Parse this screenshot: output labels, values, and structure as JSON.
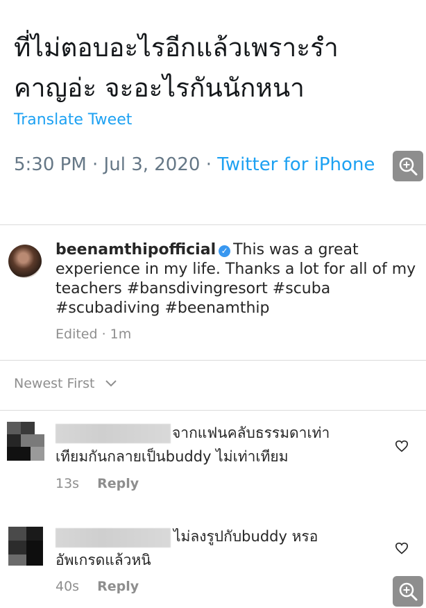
{
  "tweet": {
    "text_line1": "ที่ไม่ตอบอะไรอีกแล้วเพราะรำ",
    "text_line2": "คาญอ่ะ จะอะไรกันนักหนา",
    "translate_label": "Translate Tweet",
    "timestamp": "5:30 PM · Jul 3, 2020 · ",
    "source": "Twitter for iPhone"
  },
  "post": {
    "username": "beenamthipofficial",
    "caption": "This was a great experience in my life. Thanks a lot for all of my teachers #bansdivingresort #scuba #scubadiving #beenamthip",
    "edited": "Edited · 1m"
  },
  "comments_header": {
    "sort_label": "Newest First"
  },
  "comments": [
    {
      "line1": "จากแฟนคลับธรรมดาเท่า",
      "line2": "เทียมกันกลายเป็นbuddy ไม่เท่าเทียม",
      "time": "13s",
      "reply_label": "Reply"
    },
    {
      "line1": "ไม่ลงรูปกับbuddy หรอ",
      "line2": "อัพเกรดแล้วหนิ",
      "time": "40s",
      "reply_label": "Reply"
    }
  ],
  "icons": {
    "zoom": "zoom-in-icon",
    "verified": "verified-badge-icon",
    "chevron": "chevron-down-icon",
    "heart": "heart-outline-icon"
  },
  "colors": {
    "twitter_blue": "#1da1f2",
    "verified_blue": "#3897f0",
    "muted_gray": "#8e8e8e"
  }
}
